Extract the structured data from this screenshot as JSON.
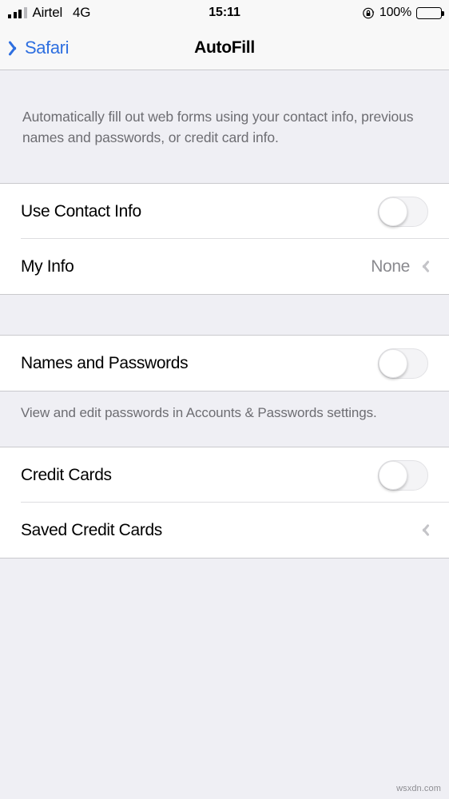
{
  "status_bar": {
    "carrier": "Airtel",
    "network": "4G",
    "time": "15:11",
    "battery_percent": "100%",
    "signal_bars_filled": 3,
    "signal_bars_total": 4,
    "rotation_lock_icon": "rotation-lock-icon",
    "battery_icon": "battery-full-icon"
  },
  "nav": {
    "back_label": "Safari",
    "back_icon": "chevron-left-icon",
    "title": "AutoFill"
  },
  "intro_text": "Automatically fill out web forms using your contact info, previous names and passwords, or credit card info.",
  "sections": [
    {
      "rows": [
        {
          "label": "Use Contact Info",
          "control": "toggle",
          "value": "off"
        },
        {
          "label": "My Info",
          "control": "disclosure",
          "value": "None"
        }
      ]
    },
    {
      "rows": [
        {
          "label": "Names and Passwords",
          "control": "toggle",
          "value": "off"
        }
      ],
      "footer": "View and edit passwords in Accounts & Passwords settings."
    },
    {
      "rows": [
        {
          "label": "Credit Cards",
          "control": "toggle",
          "value": "off"
        },
        {
          "label": "Saved Credit Cards",
          "control": "disclosure",
          "value": ""
        }
      ]
    }
  ],
  "watermark": "wsxdn.com",
  "colors": {
    "accent_blue": "#2E6FE0",
    "background": "#EFEFF4",
    "card": "#FFFFFF",
    "secondary_text": "#6D6D72",
    "value_text": "#8A8A8F"
  }
}
